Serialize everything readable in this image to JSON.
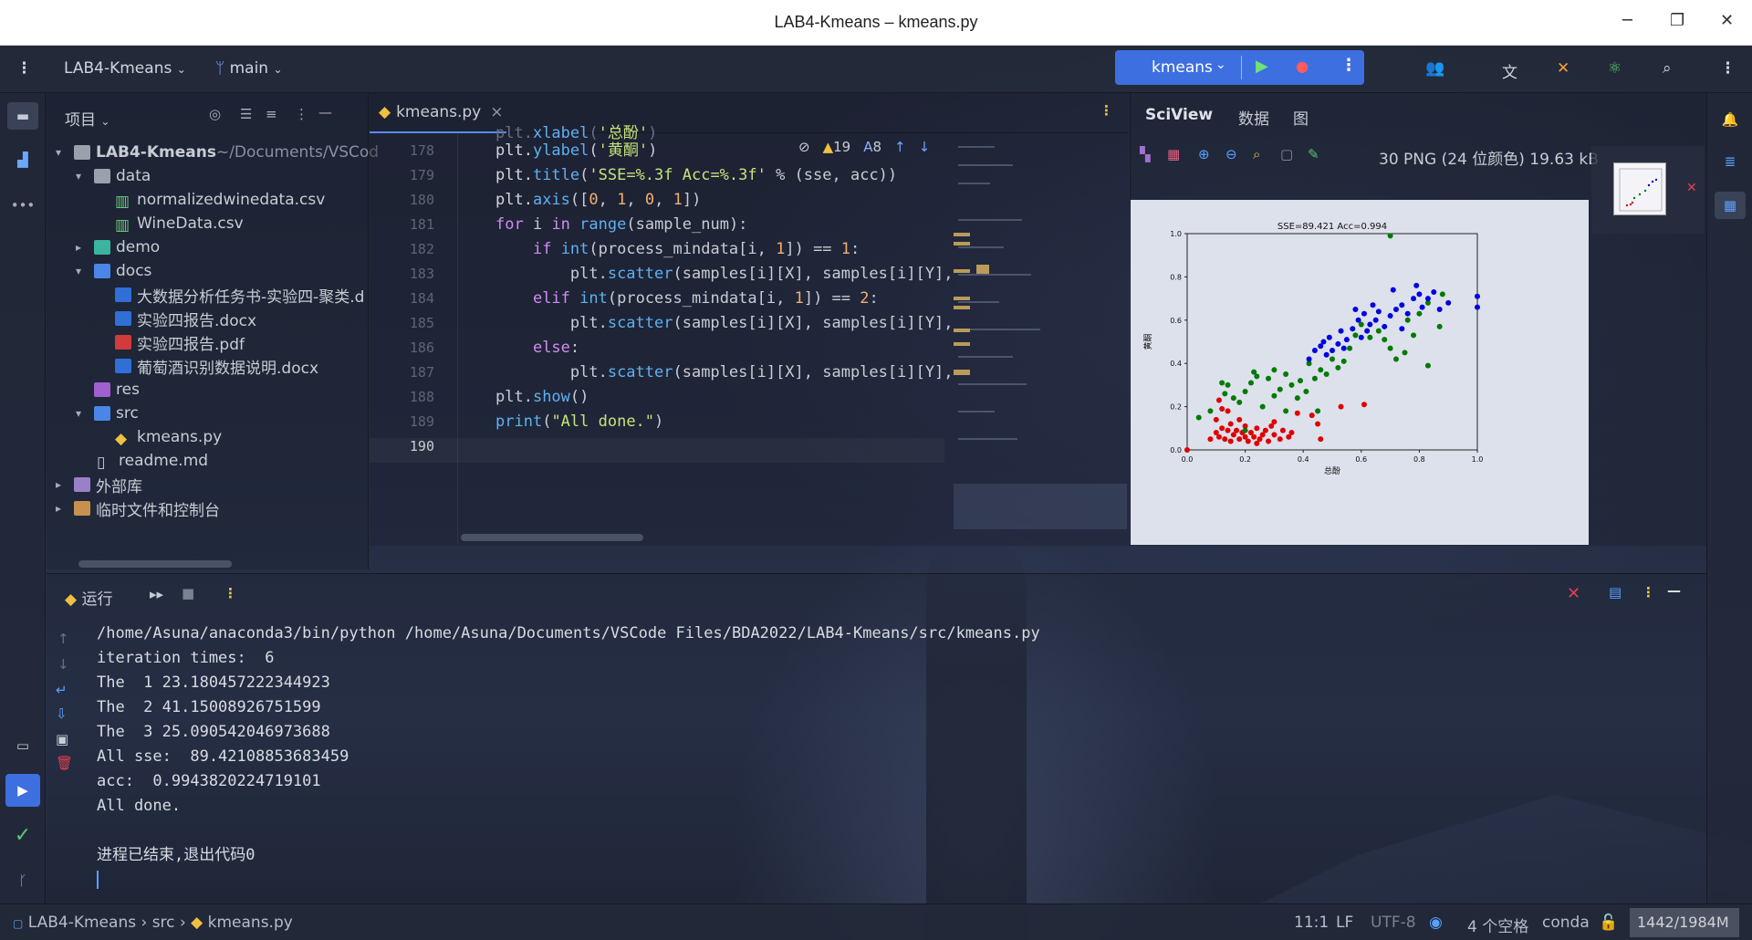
{
  "window": {
    "title": "LAB4-Kmeans – kmeans.py",
    "min": "─",
    "max": "❐",
    "close": "✕"
  },
  "toolbar": {
    "project": "LAB4-Kmeans",
    "branch": "main",
    "run_config": "kmeans"
  },
  "project_panel": {
    "title": "项目",
    "items": [
      {
        "label": "LAB4-Kmeans",
        "suffix": " ~/Documents/VSCod"
      },
      {
        "label": "data"
      },
      {
        "label": "normalizedwinedata.csv"
      },
      {
        "label": "WineData.csv"
      },
      {
        "label": "demo"
      },
      {
        "label": "docs"
      },
      {
        "label": "大数据分析任务书-实验四-聚类.d"
      },
      {
        "label": "实验四报告.docx"
      },
      {
        "label": "实验四报告.pdf"
      },
      {
        "label": "葡萄酒识别数据说明.docx"
      },
      {
        "label": "res"
      },
      {
        "label": "src"
      },
      {
        "label": "kmeans.py"
      },
      {
        "label": "readme.md"
      },
      {
        "label": "外部库"
      },
      {
        "label": "临时文件和控制台"
      }
    ]
  },
  "editor": {
    "tab": "kmeans.py",
    "warnings": "19",
    "typos": "8",
    "line_numbers": [
      "178",
      "179",
      "180",
      "181",
      "182",
      "183",
      "184",
      "185",
      "186",
      "187",
      "188",
      "189",
      "190"
    ]
  },
  "sciview": {
    "tabs": [
      "SciView",
      "数据",
      "图"
    ],
    "image_info": "30 PNG (24 位颜色) 19.63 kB"
  },
  "chart_data": {
    "type": "scatter",
    "title": "SSE=89.421  Acc=0.994",
    "xlabel": "总酚",
    "ylabel": "黄酮",
    "xlim": [
      0,
      1
    ],
    "ylim": [
      0,
      1
    ],
    "xticks": [
      "0.0",
      "0.2",
      "0.4",
      "0.6",
      "0.8",
      "1.0"
    ],
    "yticks": [
      "0.0",
      "0.2",
      "0.4",
      "0.6",
      "0.8",
      "1.0"
    ],
    "series": [
      {
        "color": "#e00000",
        "points": [
          [
            0.0,
            0.0
          ],
          [
            0.1,
            0.08
          ],
          [
            0.11,
            0.06
          ],
          [
            0.12,
            0.1
          ],
          [
            0.13,
            0.05
          ],
          [
            0.14,
            0.09
          ],
          [
            0.15,
            0.04
          ],
          [
            0.15,
            0.12
          ],
          [
            0.16,
            0.07
          ],
          [
            0.17,
            0.09
          ],
          [
            0.18,
            0.05
          ],
          [
            0.19,
            0.08
          ],
          [
            0.2,
            0.06
          ],
          [
            0.2,
            0.11
          ],
          [
            0.21,
            0.04
          ],
          [
            0.22,
            0.08
          ],
          [
            0.23,
            0.06
          ],
          [
            0.24,
            0.1
          ],
          [
            0.25,
            0.05
          ],
          [
            0.26,
            0.07
          ],
          [
            0.27,
            0.09
          ],
          [
            0.28,
            0.04
          ],
          [
            0.29,
            0.11
          ],
          [
            0.3,
            0.07
          ],
          [
            0.32,
            0.05
          ],
          [
            0.33,
            0.09
          ],
          [
            0.35,
            0.06
          ],
          [
            0.12,
            0.19
          ],
          [
            0.11,
            0.23
          ],
          [
            0.14,
            0.18
          ],
          [
            0.1,
            0.14
          ],
          [
            0.36,
            0.08
          ],
          [
            0.46,
            0.05
          ],
          [
            0.45,
            0.12
          ],
          [
            0.53,
            0.2
          ],
          [
            0.61,
            0.21
          ],
          [
            0.43,
            0.16
          ],
          [
            0.3,
            0.13
          ],
          [
            0.38,
            0.17
          ],
          [
            0.08,
            0.05
          ],
          [
            0.18,
            0.14
          ],
          [
            0.24,
            0.03
          ]
        ]
      },
      {
        "color": "#007a00",
        "points": [
          [
            0.04,
            0.15
          ],
          [
            0.08,
            0.18
          ],
          [
            0.14,
            0.3
          ],
          [
            0.13,
            0.26
          ],
          [
            0.16,
            0.24
          ],
          [
            0.18,
            0.22
          ],
          [
            0.2,
            0.27
          ],
          [
            0.22,
            0.31
          ],
          [
            0.23,
            0.36
          ],
          [
            0.24,
            0.34
          ],
          [
            0.26,
            0.2
          ],
          [
            0.28,
            0.33
          ],
          [
            0.3,
            0.25
          ],
          [
            0.3,
            0.37
          ],
          [
            0.32,
            0.28
          ],
          [
            0.34,
            0.35
          ],
          [
            0.36,
            0.3
          ],
          [
            0.38,
            0.24
          ],
          [
            0.39,
            0.32
          ],
          [
            0.41,
            0.27
          ],
          [
            0.42,
            0.4
          ],
          [
            0.44,
            0.33
          ],
          [
            0.46,
            0.37
          ],
          [
            0.48,
            0.35
          ],
          [
            0.5,
            0.42
          ],
          [
            0.52,
            0.38
          ],
          [
            0.54,
            0.41
          ],
          [
            0.56,
            0.47
          ],
          [
            0.58,
            0.53
          ],
          [
            0.6,
            0.58
          ],
          [
            0.63,
            0.52
          ],
          [
            0.66,
            0.55
          ],
          [
            0.68,
            0.51
          ],
          [
            0.7,
            0.47
          ],
          [
            0.72,
            0.42
          ],
          [
            0.75,
            0.45
          ],
          [
            0.78,
            0.53
          ],
          [
            0.8,
            0.63
          ],
          [
            0.83,
            0.68
          ],
          [
            0.87,
            0.57
          ],
          [
            0.88,
            0.72
          ],
          [
            0.83,
            0.39
          ],
          [
            0.76,
            0.6
          ],
          [
            0.12,
            0.31
          ],
          [
            0.34,
            0.18
          ],
          [
            0.45,
            0.18
          ],
          [
            0.7,
            0.99
          ],
          [
            0.2,
            0.09
          ]
        ]
      },
      {
        "color": "#0000e0",
        "points": [
          [
            0.42,
            0.42
          ],
          [
            0.44,
            0.46
          ],
          [
            0.46,
            0.48
          ],
          [
            0.47,
            0.5
          ],
          [
            0.48,
            0.44
          ],
          [
            0.5,
            0.46
          ],
          [
            0.52,
            0.49
          ],
          [
            0.53,
            0.55
          ],
          [
            0.55,
            0.51
          ],
          [
            0.57,
            0.56
          ],
          [
            0.59,
            0.6
          ],
          [
            0.6,
            0.52
          ],
          [
            0.61,
            0.63
          ],
          [
            0.63,
            0.58
          ],
          [
            0.65,
            0.6
          ],
          [
            0.66,
            0.64
          ],
          [
            0.68,
            0.57
          ],
          [
            0.7,
            0.62
          ],
          [
            0.72,
            0.65
          ],
          [
            0.74,
            0.67
          ],
          [
            0.76,
            0.63
          ],
          [
            0.78,
            0.7
          ],
          [
            0.8,
            0.72
          ],
          [
            0.81,
            0.66
          ],
          [
            0.83,
            0.7
          ],
          [
            0.85,
            0.73
          ],
          [
            0.87,
            0.65
          ],
          [
            0.9,
            0.68
          ],
          [
            1.0,
            0.66
          ],
          [
            1.0,
            0.71
          ],
          [
            0.79,
            0.76
          ],
          [
            0.71,
            0.74
          ],
          [
            0.62,
            0.55
          ],
          [
            0.54,
            0.47
          ],
          [
            0.49,
            0.52
          ],
          [
            0.58,
            0.65
          ],
          [
            0.64,
            0.67
          ],
          [
            0.74,
            0.56
          ]
        ]
      }
    ]
  },
  "run": {
    "title": "运行",
    "lines": [
      "/home/Asuna/anaconda3/bin/python /home/Asuna/Documents/VSCode Files/BDA2022/LAB4-Kmeans/src/kmeans.py",
      "iteration times:  6",
      "The  1 23.180457222344923",
      "The  2 41.15008926751599",
      "The  3 25.090542046973688",
      "All sse:  89.42108853683459",
      "acc:  0.9943820224719101",
      "All done.",
      "",
      "进程已结束,退出代码0"
    ]
  },
  "status": {
    "breadcrumb": [
      "LAB4-Kmeans",
      "src",
      "kmeans.py"
    ],
    "position": "11:1",
    "line_ending": "LF",
    "encoding": "UTF-8",
    "indent": "4 个空格",
    "interpreter": "conda",
    "memory": "1442/1984M"
  }
}
